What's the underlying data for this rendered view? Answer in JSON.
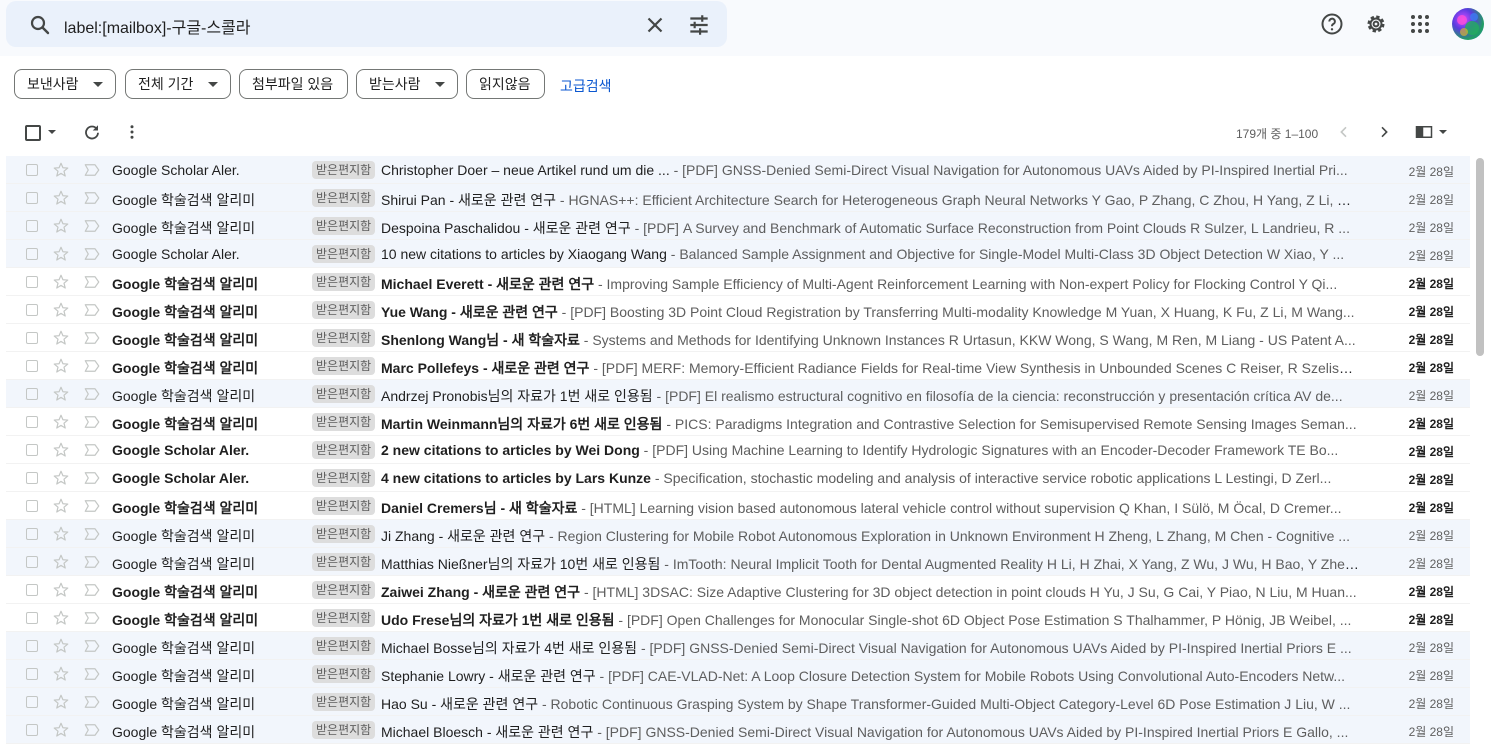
{
  "search": {
    "query": "label:[mailbox]-구글-스콜라"
  },
  "filters": [
    {
      "label": "보낸사람",
      "dropdown": true
    },
    {
      "label": "전체 기간",
      "dropdown": true
    },
    {
      "label": "첨부파일 있음",
      "dropdown": false
    },
    {
      "label": "받는사람",
      "dropdown": true
    },
    {
      "label": "읽지않음",
      "dropdown": false
    }
  ],
  "advanced_search": "고급검색",
  "pagination": {
    "text": "179개 중 1–100"
  },
  "emails": [
    {
      "sender": "Google Scholar Aler.",
      "label": "받은편지함",
      "subject": "Christopher Doer – neue Artikel rund um die ...",
      "snippet": "[PDF] GNSS-Denied Semi-Direct Visual Navigation for Autonomous UAVs Aided by PI-Inspired Inertial Pri...",
      "date": "2월 28일",
      "unread": false
    },
    {
      "sender": "Google 학술검색 알리미",
      "label": "받은편지함",
      "subject": "Shirui Pan - 새로운 관련 연구",
      "snippet": "HGNAS++: Efficient Architecture Search for Heterogeneous Graph Neural Networks Y Gao, P Zhang, C Zhou, H Yang, Z Li, Y ...",
      "date": "2월 28일",
      "unread": false
    },
    {
      "sender": "Google 학술검색 알리미",
      "label": "받은편지함",
      "subject": "Despoina Paschalidou - 새로운 관련 연구",
      "snippet": "[PDF] A Survey and Benchmark of Automatic Surface Reconstruction from Point Clouds R Sulzer, L Landrieu, R ...",
      "date": "2월 28일",
      "unread": false
    },
    {
      "sender": "Google Scholar Aler.",
      "label": "받은편지함",
      "subject": "10 new citations to articles by Xiaogang Wang",
      "snippet": "Balanced Sample Assignment and Objective for Single-Model Multi-Class 3D Object Detection W Xiao, Y ...",
      "date": "2월 28일",
      "unread": false
    },
    {
      "sender": "Google 학술검색 알리미",
      "label": "받은편지함",
      "subject": "Michael Everett - 새로운 관련 연구",
      "snippet": "Improving Sample Efficiency of Multi-Agent Reinforcement Learning with Non-expert Policy for Flocking Control Y Qi...",
      "date": "2월 28일",
      "unread": true
    },
    {
      "sender": "Google 학술검색 알리미",
      "label": "받은편지함",
      "subject": "Yue Wang - 새로운 관련 연구",
      "snippet": "[PDF] Boosting 3D Point Cloud Registration by Transferring Multi-modality Knowledge M Yuan, X Huang, K Fu, Z Li, M Wang...",
      "date": "2월 28일",
      "unread": true
    },
    {
      "sender": "Google 학술검색 알리미",
      "label": "받은편지함",
      "subject": "Shenlong Wang님 - 새 학술자료",
      "snippet": "Systems and Methods for Identifying Unknown Instances R Urtasun, KKW Wong, S Wang, M Ren, M Liang - US Patent A...",
      "date": "2월 28일",
      "unread": true
    },
    {
      "sender": "Google 학술검색 알리미",
      "label": "받은편지함",
      "subject": "Marc Pollefeys - 새로운 관련 연구",
      "snippet": "[PDF] MERF: Memory-Efficient Radiance Fields for Real-time View Synthesis in Unbounded Scenes C Reiser, R Szeliski...",
      "date": "2월 28일",
      "unread": true
    },
    {
      "sender": "Google 학술검색 알리미",
      "label": "받은편지함",
      "subject": "Andrzej Pronobis님의 자료가 1번 새로 인용됨",
      "snippet": "[PDF] El realismo estructural cognitivo en filosofía de la ciencia: reconstrucción y presentación crítica AV de...",
      "date": "2월 28일",
      "unread": false
    },
    {
      "sender": "Google 학술검색 알리미",
      "label": "받은편지함",
      "subject": "Martin Weinmann님의 자료가 6번 새로 인용됨",
      "snippet": "PICS: Paradigms Integration and Contrastive Selection for Semisupervised Remote Sensing Images Seman...",
      "date": "2월 28일",
      "unread": true
    },
    {
      "sender": "Google Scholar Aler.",
      "label": "받은편지함",
      "subject": "2 new citations to articles by Wei Dong",
      "snippet": "[PDF] Using Machine Learning to Identify Hydrologic Signatures with an Encoder-Decoder Framework TE Bo...",
      "date": "2월 28일",
      "unread": true
    },
    {
      "sender": "Google Scholar Aler.",
      "label": "받은편지함",
      "subject": "4 new citations to articles by Lars Kunze",
      "snippet": "Specification, stochastic modeling and analysis of interactive service robotic applications L Lestingi, D Zerl...",
      "date": "2월 28일",
      "unread": true
    },
    {
      "sender": "Google 학술검색 알리미",
      "label": "받은편지함",
      "subject": "Daniel Cremers님 - 새 학술자료",
      "snippet": "[HTML] Learning vision based autonomous lateral vehicle control without supervision Q Khan, I Sülö, M Öcal, D Cremer...",
      "date": "2월 28일",
      "unread": true
    },
    {
      "sender": "Google 학술검색 알리미",
      "label": "받은편지함",
      "subject": "Ji Zhang - 새로운 관련 연구",
      "snippet": "Region Clustering for Mobile Robot Autonomous Exploration in Unknown Environment H Zheng, L Zhang, M Chen - Cognitive ...",
      "date": "2월 28일",
      "unread": false
    },
    {
      "sender": "Google 학술검색 알리미",
      "label": "받은편지함",
      "subject": "Matthias Nießner님의 자료가 10번 새로 인용됨",
      "snippet": "ImTooth: Neural Implicit Tooth for Dental Augmented Reality H Li, H Zhai, X Yang, Z Wu, J Wu, H Bao, Y Zhen...",
      "date": "2월 28일",
      "unread": false
    },
    {
      "sender": "Google 학술검색 알리미",
      "label": "받은편지함",
      "subject": "Zaiwei Zhang - 새로운 관련 연구",
      "snippet": "[HTML] 3DSAC: Size Adaptive Clustering for 3D object detection in point clouds H Yu, J Su, G Cai, Y Piao, N Liu, M Huan...",
      "date": "2월 28일",
      "unread": true
    },
    {
      "sender": "Google 학술검색 알리미",
      "label": "받은편지함",
      "subject": "Udo Frese님의 자료가 1번 새로 인용됨",
      "snippet": "[PDF] Open Challenges for Monocular Single-shot 6D Object Pose Estimation S Thalhammer, P Hönig, JB Weibel, ...",
      "date": "2월 28일",
      "unread": true
    },
    {
      "sender": "Google 학술검색 알리미",
      "label": "받은편지함",
      "subject": "Michael Bosse님의 자료가 4번 새로 인용됨",
      "snippet": "[PDF] GNSS-Denied Semi-Direct Visual Navigation for Autonomous UAVs Aided by PI-Inspired Inertial Priors E ...",
      "date": "2월 28일",
      "unread": false
    },
    {
      "sender": "Google 학술검색 알리미",
      "label": "받은편지함",
      "subject": "Stephanie Lowry - 새로운 관련 연구",
      "snippet": "[PDF] CAE-VLAD-Net: A Loop Closure Detection System for Mobile Robots Using Convolutional Auto-Encoders Netw...",
      "date": "2월 28일",
      "unread": false
    },
    {
      "sender": "Google 학술검색 알리미",
      "label": "받은편지함",
      "subject": "Hao Su - 새로운 관련 연구",
      "snippet": "Robotic Continuous Grasping System by Shape Transformer-Guided Multi-Object Category-Level 6D Pose Estimation J Liu, W ...",
      "date": "2월 28일",
      "unread": false
    },
    {
      "sender": "Google 학술검색 알리미",
      "label": "받은편지함",
      "subject": "Michael Bloesch - 새로운 관련 연구",
      "snippet": "[PDF] GNSS-Denied Semi-Direct Visual Navigation for Autonomous UAVs Aided by PI-Inspired Inertial Priors E Gallo, ...",
      "date": "2월 28일",
      "unread": false
    }
  ]
}
